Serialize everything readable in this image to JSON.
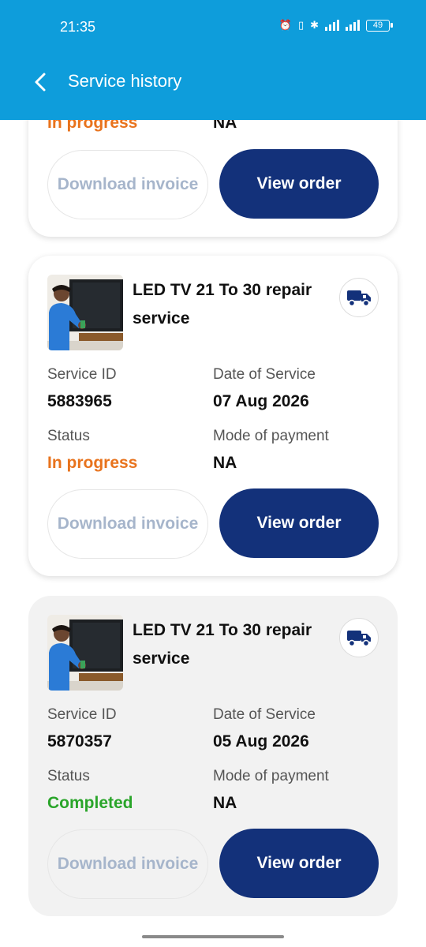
{
  "status_bar": {
    "time": "21:35",
    "battery": "49"
  },
  "header": {
    "title": "Service history"
  },
  "labels": {
    "service_id": "Service ID",
    "date_of_service": "Date of Service",
    "status": "Status",
    "mode_of_payment": "Mode of payment",
    "download_invoice": "Download invoice",
    "view_order": "View order"
  },
  "cards": [
    {
      "status": "In progress",
      "mode_of_payment": "NA"
    },
    {
      "title": "LED TV 21 To 30 repair service",
      "service_id": "5883965",
      "date": "07 Aug 2026",
      "status": "In progress",
      "mode_of_payment": "NA"
    },
    {
      "title": "LED TV 21 To 30 repair service",
      "service_id": "5870357",
      "date": "05 Aug 2026",
      "status": "Completed",
      "mode_of_payment": "NA"
    }
  ],
  "colors": {
    "header": "#0e9ddb",
    "primary": "#13317a",
    "in_progress": "#e8731d",
    "completed": "#2aa52a"
  }
}
